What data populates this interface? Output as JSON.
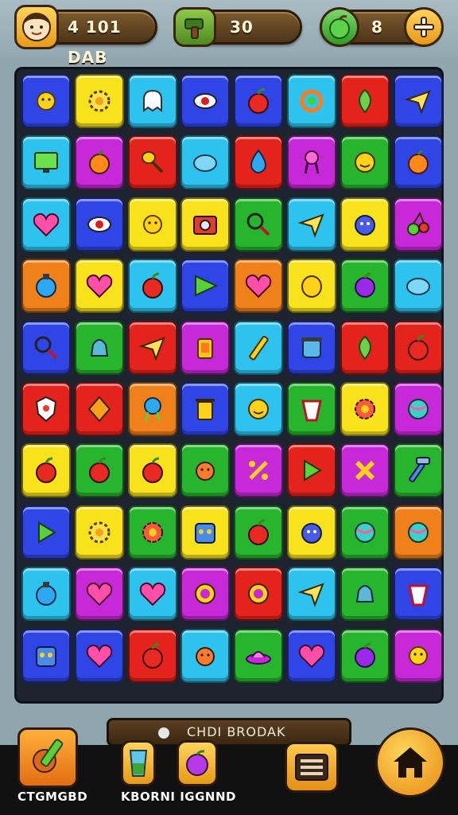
{
  "hud": {
    "score": "4 101 DAB",
    "moves": "30",
    "lives": "8",
    "avatar_icon": "player-avatar-icon",
    "moves_icon": "hammer-icon",
    "lives_icon": "apple-icon",
    "add_icon": "plus-icon"
  },
  "status": {
    "text": "CHDI BRODAK"
  },
  "bottom": {
    "left_label": "CTGMGBD",
    "center_label": "KBORNI IGGNND",
    "left_icon": "pencil-tool-icon",
    "item1_icon": "potion-glass-icon",
    "item2_icon": "grape-fruit-icon",
    "menu_icon": "menu-icon",
    "home_icon": "home-icon"
  },
  "board": {
    "rows": 10,
    "cols": 8,
    "colors": {
      "B": "#2f45e6",
      "Y": "#f7e21b",
      "C": "#2ec3ef",
      "G": "#27b52e",
      "R": "#e4231c",
      "M": "#c729d9",
      "O": "#f0801a"
    },
    "tiles": [
      [
        "B",
        "Y",
        "C",
        "B",
        "B",
        "C",
        "R",
        "B"
      ],
      [
        "C",
        "M",
        "R",
        "C",
        "R",
        "M",
        "G",
        "B"
      ],
      [
        "C",
        "B",
        "Y",
        "Y",
        "G",
        "C",
        "Y",
        "M"
      ],
      [
        "O",
        "Y",
        "C",
        "B",
        "O",
        "Y",
        "G",
        "C"
      ],
      [
        "B",
        "G",
        "R",
        "M",
        "C",
        "B",
        "R",
        "R"
      ],
      [
        "R",
        "R",
        "O",
        "B",
        "C",
        "G",
        "Y",
        "M"
      ],
      [
        "Y",
        "G",
        "Y",
        "G",
        "M",
        "R",
        "M",
        "G"
      ],
      [
        "B",
        "Y",
        "G",
        "Y",
        "G",
        "Y",
        "G",
        "O"
      ],
      [
        "C",
        "M",
        "C",
        "M",
        "R",
        "C",
        "G",
        "B"
      ],
      [
        "B",
        "B",
        "R",
        "C",
        "G",
        "B",
        "G",
        "M"
      ]
    ],
    "icons": [
      [
        "sun-icon",
        "gear-icon",
        "ghost-icon",
        "eye-icon",
        "apple-icon",
        "swirl-icon",
        "leaf-icon",
        "paper-plane-icon"
      ],
      [
        "monitor-icon",
        "fruit-icon",
        "spoon-icon",
        "blob-icon",
        "drop-icon",
        "ribbon-icon",
        "smiley-icon",
        "fruit-icon"
      ],
      [
        "heart-icon",
        "eye-icon",
        "sun-icon",
        "camera-icon",
        "magnifier-icon",
        "paper-plane-icon",
        "monster-icon",
        "cherry-icon"
      ],
      [
        "potion-icon",
        "heart-icon",
        "apple-icon",
        "arrow-icon",
        "heart-icon",
        "lemon-icon",
        "plum-icon",
        "blob-icon"
      ],
      [
        "magnifier-icon",
        "bell-icon",
        "paper-plane-icon",
        "lantern-icon",
        "pencil-icon",
        "jar-icon",
        "leaf-icon",
        "apple-icon"
      ],
      [
        "shield-icon",
        "diamond-icon",
        "badge-icon",
        "trash-icon",
        "smiley-icon",
        "cup-icon",
        "flower-icon",
        "ball-icon"
      ],
      [
        "apple-icon",
        "apple-icon",
        "apple-icon",
        "bug-icon",
        "percent-icon",
        "play-icon",
        "cross-icon",
        "hammer-icon"
      ],
      [
        "play-icon",
        "gear-icon",
        "flower-icon",
        "robot-icon",
        "apple-icon",
        "monster-icon",
        "ball-icon",
        "ball-icon"
      ],
      [
        "potion-icon",
        "heart-icon",
        "heart-icon",
        "ring-icon",
        "ring-icon",
        "paper-plane-icon",
        "bell-icon",
        "cup-icon"
      ],
      [
        "robot-icon",
        "heart-icon",
        "apple-icon",
        "bug-icon",
        "ufo-icon",
        "heart-icon",
        "plum-icon",
        "sun-icon"
      ]
    ]
  }
}
